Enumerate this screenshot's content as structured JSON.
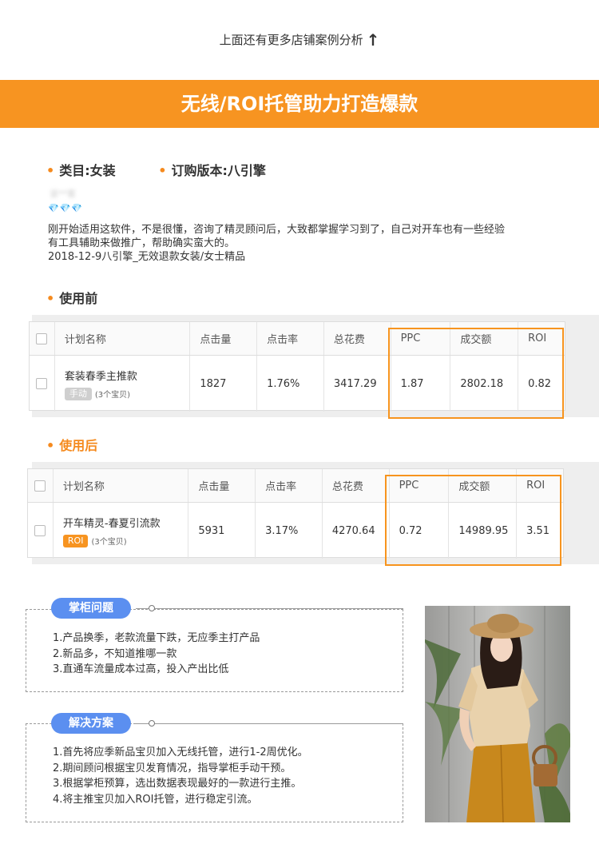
{
  "top_link": {
    "text": "上面还有更多店铺案例分析",
    "arrow": "↑"
  },
  "banner": {
    "title": "无线/ROI托管助力打造爆款"
  },
  "meta": {
    "category": "类目:女装",
    "version": "订购版本:八引擎"
  },
  "reviewer": {
    "name": "该**客",
    "gems": "💎💎💎"
  },
  "review": {
    "lines": [
      "刚开始适用这软件，不是很懂，咨询了精灵顾问后，大致都掌握学习到了，自己对开车也有一些经验",
      "有工具辅助来做推广，帮助确实蛮大的。",
      "2018-12-9八引擎_无效退款女装/女士精品"
    ]
  },
  "before": {
    "label": "使用前",
    "headers": {
      "name": "计划名称",
      "clicks": "点击量",
      "ctr": "点击率",
      "cost": "总花费",
      "ppc": "PPC",
      "deal": "成交额",
      "roi": "ROI"
    },
    "row": {
      "name": "套装春季主推款",
      "tag": "手动",
      "items": "(3个宝贝)",
      "clicks": "1827",
      "ctr": "1.76%",
      "cost": "3417.29",
      "ppc": "1.87",
      "deal": "2802.18",
      "roi": "0.82"
    }
  },
  "after": {
    "label": "使用后",
    "headers": {
      "name": "计划名称",
      "clicks": "点击量",
      "ctr": "点击率",
      "cost": "总花费",
      "ppc": "PPC",
      "deal": "成交额",
      "roi": "ROI"
    },
    "row": {
      "name": "开车精灵-春夏引流款",
      "tag": "ROI",
      "items": "(3个宝贝)",
      "clicks": "5931",
      "ctr": "3.17%",
      "cost": "4270.64",
      "ppc": "0.72",
      "deal": "14989.95",
      "roi": "3.51"
    }
  },
  "problems": {
    "title": "掌柜问题",
    "items": [
      "1.产品换季，老款流量下跌，无应季主打产品",
      "2.新品多，不知道推哪一款",
      "3.直通车流量成本过高，投入产出比低"
    ]
  },
  "solutions": {
    "title": "解决方案",
    "items": [
      "1.首先将应季新品宝贝加入无线托管，进行1-2周优化。",
      "2.期间顾问根据宝贝发育情况，指导掌柜手动干预。",
      "3.根据掌柜预算，选出数据表现最好的一款进行主推。",
      "4.将主推宝贝加入ROI托管，进行稳定引流。"
    ]
  }
}
